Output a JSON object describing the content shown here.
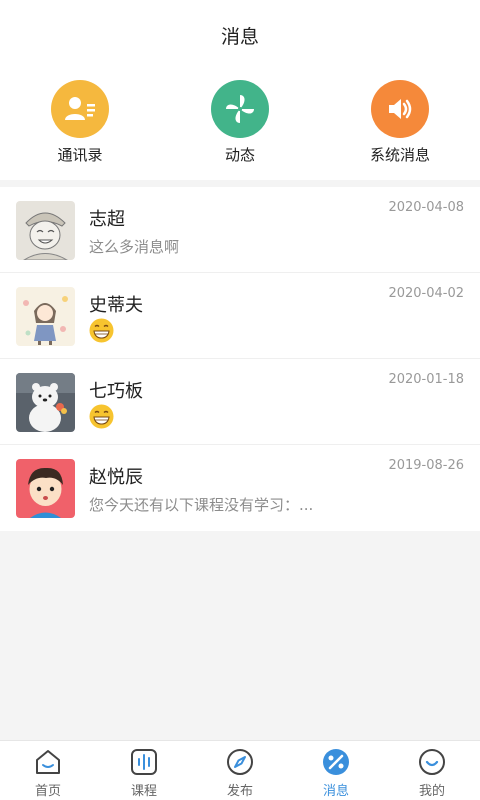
{
  "header": {
    "title": "消息"
  },
  "quick_actions": [
    {
      "label": "通讯录",
      "icon": "contacts-icon",
      "color": "#f5b83e"
    },
    {
      "label": "动态",
      "icon": "pinwheel-icon",
      "color": "#42b48a"
    },
    {
      "label": "系统消息",
      "icon": "speaker-icon",
      "color": "#f5893a"
    }
  ],
  "conversations": [
    {
      "name": "志超",
      "date": "2020-04-08",
      "preview": "这么多消息啊",
      "avatar": "sketch-boy-avatar"
    },
    {
      "name": "史蒂夫",
      "date": "2020-04-02",
      "preview": "",
      "preview_icon": "grin-emoji-icon",
      "avatar": "girl-flowers-avatar"
    },
    {
      "name": "七巧板",
      "date": "2020-01-18",
      "preview": "",
      "preview_icon": "grin-emoji-icon",
      "avatar": "polar-bear-avatar"
    },
    {
      "name": "赵悦辰",
      "date": "2019-08-26",
      "preview": "您今天还有以下课程没有学习：...",
      "avatar": "cartoon-boy-avatar"
    }
  ],
  "tabbar": {
    "active_color": "#3a8fdc",
    "items": [
      {
        "label": "首页",
        "icon": "home-icon"
      },
      {
        "label": "课程",
        "icon": "course-icon"
      },
      {
        "label": "发布",
        "icon": "compass-icon"
      },
      {
        "label": "消息",
        "icon": "message-icon",
        "active": true
      },
      {
        "label": "我的",
        "icon": "profile-icon"
      }
    ]
  }
}
